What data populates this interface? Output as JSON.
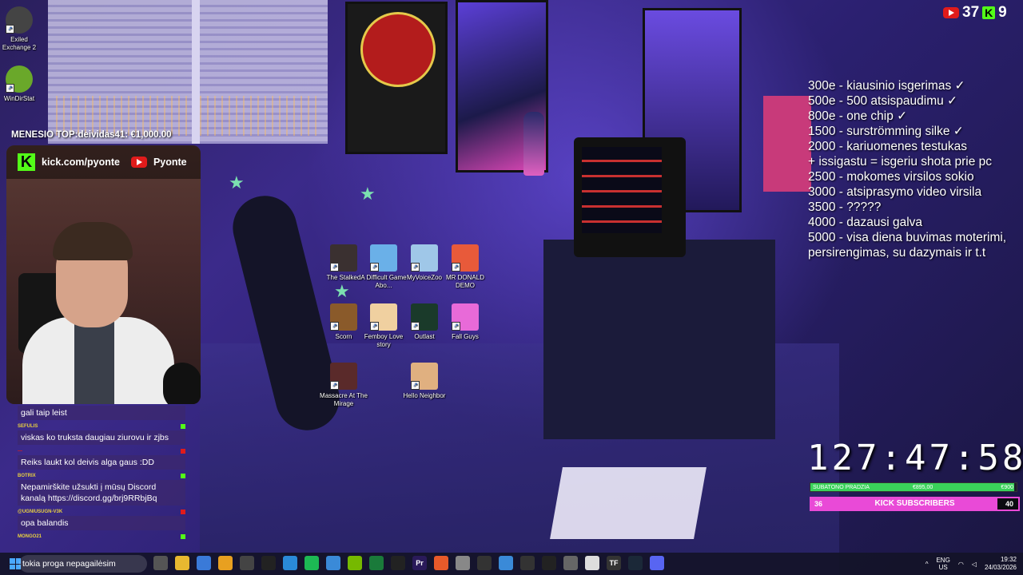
{
  "desktop_left_icons": [
    {
      "label": "Exiled\nExchange 2",
      "icon": "exiled-exchange-icon"
    },
    {
      "label": "WinDirStat",
      "icon": "windirstat-icon"
    }
  ],
  "desktop_center_icons": [
    {
      "label": "The Stalked",
      "icon": "the-stalked-icon",
      "color": "#3a3030"
    },
    {
      "label": "A Difficult Game Abo...",
      "icon": "difficult-game-icon",
      "color": "#6ab0e8"
    },
    {
      "label": "MyVoiceZoo",
      "icon": "myvoicezoo-icon",
      "color": "#9fc7e8"
    },
    {
      "label": "MR DONALD DEMO",
      "icon": "mr-donald-icon",
      "color": "#e85a3a"
    },
    {
      "label": "Scorn",
      "icon": "scorn-icon",
      "color": "#8a5a2a"
    },
    {
      "label": "Femboy Love story",
      "icon": "femboy-love-icon",
      "color": "#f0d0a0"
    },
    {
      "label": "Outlast",
      "icon": "outlast-icon",
      "color": "#1a3a2a"
    },
    {
      "label": "Fall Guys",
      "icon": "fall-guys-icon",
      "color": "#e86ad8"
    },
    {
      "label": "Massacre At The Mirage",
      "icon": "massacre-icon",
      "color": "#5a2a2a"
    },
    {
      "label": "Hello Neighbor",
      "icon": "hello-neighbor-icon",
      "color": "#e0b080"
    }
  ],
  "counters": {
    "youtube": "37",
    "kick": "9"
  },
  "goals": [
    "300e - kiausinio isgerimas ✓",
    "500e - 500 atsispaudimu ✓",
    "800e - one chip ✓",
    "1500 - surströmming silke ✓",
    "2000 - kariuomenes testukas",
    "+ issigastu = isgeriu shota prie pc",
    "2500 - mokomes virsilos sokio",
    "3000 - atsiprasymo video virsila",
    "3500 - ?????",
    "4000 - dazausi galva",
    "5000 - visa diena buvimas moterimi,",
    "persirengimas, su dazymais ir t.t"
  ],
  "timer": "127:47:58",
  "subathon_bar": {
    "label": "SUBATONO PRADZIA",
    "current": "€895,00",
    "goal": "€900",
    "progress": 0.99
  },
  "kick_bar": {
    "current": "36",
    "label": "KICK SUBSCRIBERS",
    "goal": "40",
    "progress": 0.9
  },
  "top_banner": "MENESIO TOP:deividas41: €1,000.00",
  "webcam_header": {
    "kick_url": "kick.com/pyonte",
    "youtube_name": "Pyonte"
  },
  "chat": [
    {
      "user": "",
      "text": "gali taip leist",
      "color": "#ffffff"
    },
    {
      "user": "SEFULIS",
      "text": "viskas ko truksta daugiau ziurovu ir zjbs",
      "color": "#53fc18"
    },
    {
      "user": "",
      "text": "Reiks laukt kol deivis alga gaus :DD",
      "color": "#e01b1b"
    },
    {
      "user": "BOTRIX",
      "text": "Nepamirškite užsukti į mūsų Discord kanalą https://discord.gg/brj9RRbjBq",
      "color": "#53fc18"
    },
    {
      "user": "@UGNIUSUGN-V3K",
      "text": "opa balandis",
      "color": "#53fc18"
    },
    {
      "user": "MONGO21",
      "text": "",
      "color": "#53fc18"
    }
  ],
  "taskbar": {
    "search_text": "tokia proga nepagailėsim",
    "apps": [
      {
        "icon": "task-view-icon",
        "label": "",
        "color": "#555"
      },
      {
        "icon": "file-explorer-icon",
        "label": "",
        "color": "#e8b830"
      },
      {
        "icon": "ms-store-icon",
        "label": "",
        "color": "#3a7ad8"
      },
      {
        "icon": "chrome-icon",
        "label": "",
        "color": "#e8a020"
      },
      {
        "icon": "obs-icon",
        "label": "",
        "color": "#444"
      },
      {
        "icon": "inkscape-icon",
        "label": "",
        "color": "#222"
      },
      {
        "icon": "edge-icon",
        "label": "",
        "color": "#2a8ad8"
      },
      {
        "icon": "spotify-icon",
        "label": "",
        "color": "#1db954"
      },
      {
        "icon": "photos-icon",
        "label": "",
        "color": "#3a8ad8"
      },
      {
        "icon": "nvidia-icon",
        "label": "",
        "color": "#76b900"
      },
      {
        "icon": "sheets-icon",
        "label": "",
        "color": "#1a7a3a"
      },
      {
        "icon": "capcut-icon",
        "label": "",
        "color": "#222"
      },
      {
        "icon": "premiere-icon",
        "label": "Pr",
        "color": "#2a1a5a"
      },
      {
        "icon": "brave-icon",
        "label": "",
        "color": "#e85a2a"
      },
      {
        "icon": "printer-icon",
        "label": "",
        "color": "#888"
      },
      {
        "icon": "pen-icon",
        "label": "",
        "color": "#333"
      },
      {
        "icon": "notepad-icon",
        "label": "",
        "color": "#3a8ad8"
      },
      {
        "icon": "settings-icon",
        "label": "",
        "color": "#333"
      },
      {
        "icon": "terminal-icon",
        "label": "",
        "color": "#222"
      },
      {
        "icon": "window-icon",
        "label": "",
        "color": "#666"
      },
      {
        "icon": "game-icon",
        "label": "",
        "color": "#ddd"
      },
      {
        "icon": "tf-icon",
        "label": "TF",
        "color": "#333"
      },
      {
        "icon": "steam-icon",
        "label": "",
        "color": "#1b2838"
      },
      {
        "icon": "discord-icon",
        "label": "",
        "color": "#5865f2"
      }
    ],
    "lang_top": "ENG",
    "lang_bottom": "US",
    "time": "19:32",
    "date": "24/03/2026"
  }
}
